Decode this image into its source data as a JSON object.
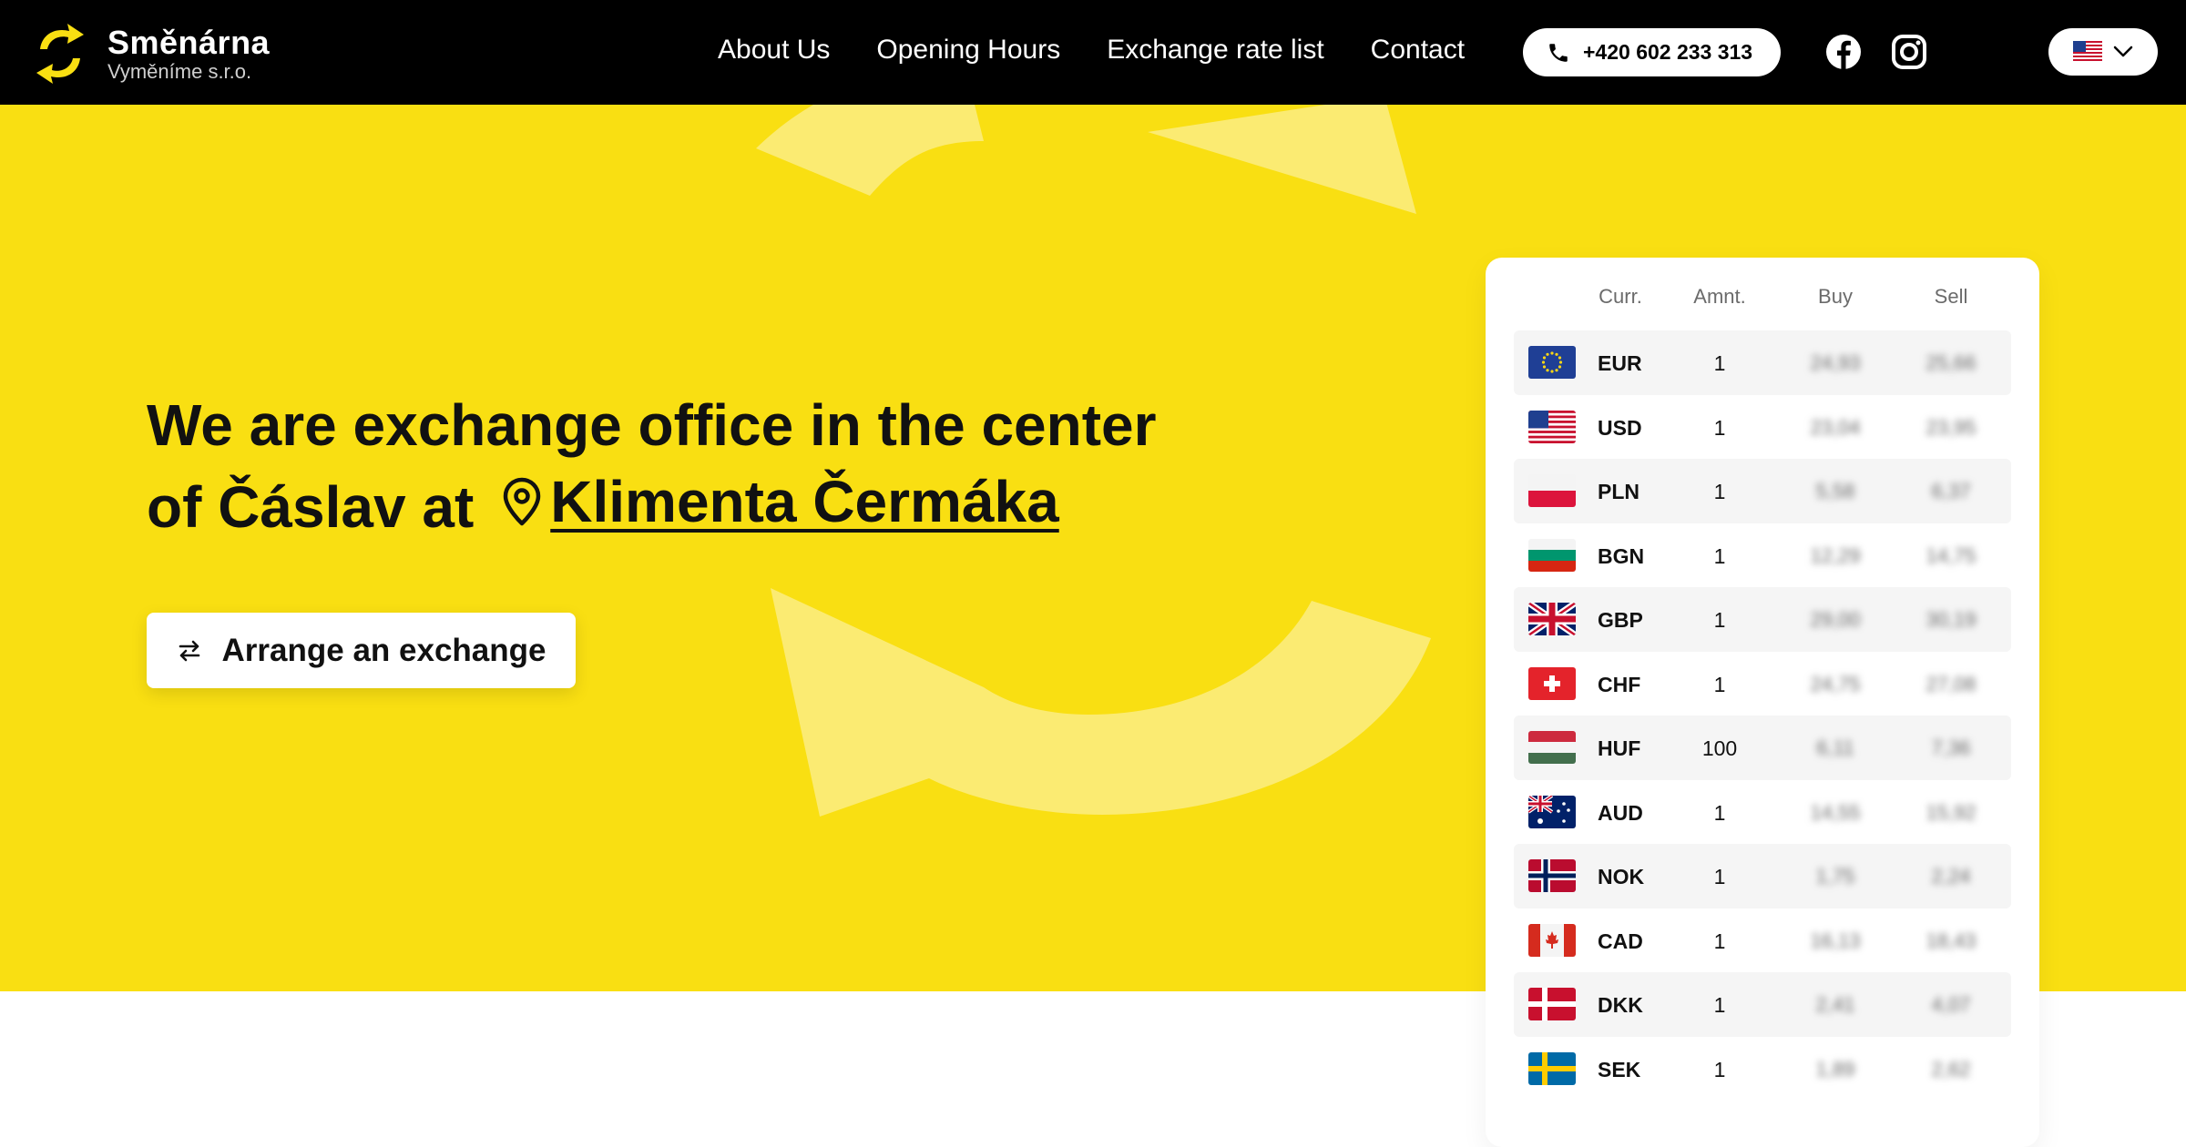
{
  "header": {
    "brand_name": "Směnárna",
    "brand_sub": "Vyměníme s.r.o.",
    "nav": [
      "About Us",
      "Opening Hours",
      "Exchange rate list",
      "Contact"
    ],
    "phone": "+420 602 233 313",
    "icons": {
      "phone": "phone-icon",
      "facebook": "facebook-icon",
      "instagram": "instagram-icon",
      "language_flag": "us-flag-icon",
      "dropdown": "chevron-down-icon"
    }
  },
  "hero": {
    "headline_line1": "We are exchange office in the center",
    "headline_line2_prefix": "of Čáslav at",
    "location": "Klimenta Čermáka",
    "cta_label": "Arrange an exchange",
    "background_color": "#f9df12"
  },
  "rates": {
    "columns": [
      "Curr.",
      "Amnt.",
      "Buy",
      "Sell"
    ],
    "rows": [
      {
        "currency": "EUR",
        "amount": "1",
        "buy": "24,93",
        "sell": "25,66",
        "flag": "eu-flag-icon"
      },
      {
        "currency": "USD",
        "amount": "1",
        "buy": "23,04",
        "sell": "23,95",
        "flag": "us-flag-icon"
      },
      {
        "currency": "PLN",
        "amount": "1",
        "buy": "5,58",
        "sell": "6,37",
        "flag": "pl-flag-icon"
      },
      {
        "currency": "BGN",
        "amount": "1",
        "buy": "12,29",
        "sell": "14,75",
        "flag": "bg-flag-icon"
      },
      {
        "currency": "GBP",
        "amount": "1",
        "buy": "29,00",
        "sell": "30,19",
        "flag": "gb-flag-icon"
      },
      {
        "currency": "CHF",
        "amount": "1",
        "buy": "24,75",
        "sell": "27,08",
        "flag": "ch-flag-icon"
      },
      {
        "currency": "HUF",
        "amount": "100",
        "buy": "6,11",
        "sell": "7,36",
        "flag": "hu-flag-icon"
      },
      {
        "currency": "AUD",
        "amount": "1",
        "buy": "14,55",
        "sell": "15,92",
        "flag": "au-flag-icon"
      },
      {
        "currency": "NOK",
        "amount": "1",
        "buy": "1,75",
        "sell": "2,24",
        "flag": "no-flag-icon"
      },
      {
        "currency": "CAD",
        "amount": "1",
        "buy": "16,13",
        "sell": "18,43",
        "flag": "ca-flag-icon"
      },
      {
        "currency": "DKK",
        "amount": "1",
        "buy": "2,41",
        "sell": "4,07",
        "flag": "dk-flag-icon"
      },
      {
        "currency": "SEK",
        "amount": "1",
        "buy": "1,89",
        "sell": "2,62",
        "flag": "se-flag-icon"
      }
    ]
  }
}
